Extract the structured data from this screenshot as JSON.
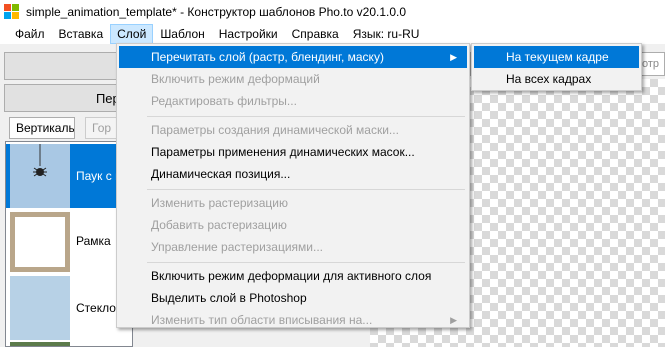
{
  "window": {
    "title": "simple_animation_template* - Конструктор шаблонов Pho.to v20.1.0.0"
  },
  "menubar": {
    "items": [
      "Файл",
      "Вставка",
      "Слой",
      "Шаблон",
      "Настройки",
      "Справка",
      "Язык: ru-RU"
    ]
  },
  "left_panel": {
    "top_button_label": "",
    "second_button_label": "Пере",
    "vertical_button_label": "Вертикаль",
    "horizontal_button_label": "Гор",
    "layers": [
      {
        "label": "Паук с г",
        "selected": true,
        "icon": "spider-thumbnail"
      },
      {
        "label": "Рамка",
        "selected": false,
        "icon": "frame-thumbnail"
      },
      {
        "label": "Стекло",
        "selected": false,
        "icon": "glass-thumbnail"
      },
      {
        "label": "",
        "selected": false,
        "icon": "photo-thumbnail"
      }
    ]
  },
  "right_panel": {
    "partial_text": "отр"
  },
  "layer_menu": {
    "items": [
      {
        "label": "Перечитать слой (растр, блендинг, маску)",
        "enabled": true,
        "highlighted": true,
        "submenu": true
      },
      {
        "label": "Включить режим деформаций",
        "enabled": false
      },
      {
        "label": "Редактировать фильтры...",
        "enabled": false
      },
      {
        "label": "Параметры создания динамической маски...",
        "enabled": false
      },
      {
        "label": "Параметры применения динамических масок...",
        "enabled": true
      },
      {
        "label": "Динамическая позиция...",
        "enabled": true
      },
      {
        "label": "Изменить растеризацию",
        "enabled": false
      },
      {
        "label": "Добавить растеризацию",
        "enabled": false
      },
      {
        "label": "Управление растеризациями...",
        "enabled": false
      },
      {
        "label": "Включить режим деформации для активного слоя",
        "enabled": true
      },
      {
        "label": "Выделить слой в Photoshop",
        "enabled": true
      },
      {
        "label": "Изменить тип области вписывания на...",
        "enabled": false,
        "submenu": true
      }
    ]
  },
  "reread_submenu": {
    "items": [
      {
        "label": "На текущем кадре",
        "highlighted": true
      },
      {
        "label": "На всех кадрах",
        "highlighted": false
      }
    ]
  },
  "colors": {
    "accent": "#0078d7",
    "menu_active_bg": "#cce8ff",
    "disabled_text": "#a0a0a0"
  }
}
